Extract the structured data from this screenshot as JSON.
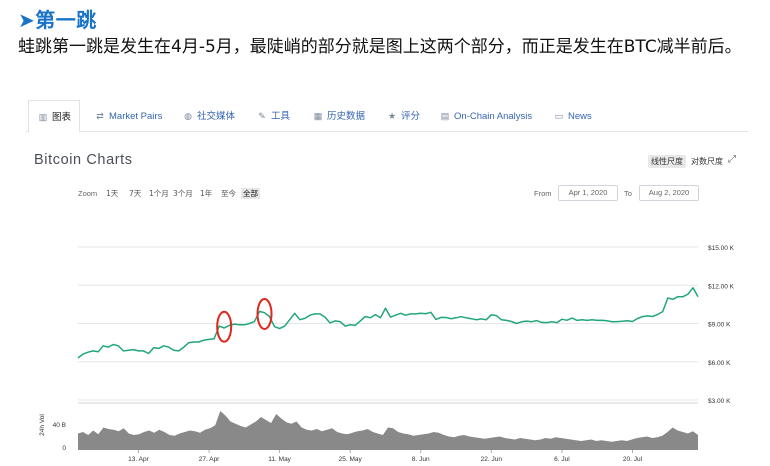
{
  "article": {
    "heading": "➤第一跳",
    "body": "蛙跳第一跳是发生在4月-5月，最陡峭的部分就是图上这两个部分，而正是发生在BTC减半前后。"
  },
  "tabs": [
    {
      "label": "图表",
      "icon": "chart-icon",
      "active": true
    },
    {
      "label": "Market Pairs",
      "icon": "exchange-icon"
    },
    {
      "label": "社交媒体",
      "icon": "globe-icon"
    },
    {
      "label": "工具",
      "icon": "wrench-icon"
    },
    {
      "label": "历史数据",
      "icon": "calendar-icon"
    },
    {
      "label": "评分",
      "icon": "star-icon"
    },
    {
      "label": "On-Chain Analysis",
      "icon": "line-chart-icon"
    },
    {
      "label": "News",
      "icon": "newspaper-icon"
    }
  ],
  "chart_header": {
    "title": "Bitcoin Charts",
    "linear_scale": "线性尺度",
    "log_scale": "对数尺度",
    "active_scale": "linear"
  },
  "zoom": {
    "label": "Zoom",
    "options": [
      "1天",
      "7天",
      "1个月",
      "3个月",
      "1年",
      "至今",
      "全部"
    ],
    "active": "全部"
  },
  "date_range": {
    "from_label": "From",
    "from_value": "Apr 1, 2020",
    "to_label": "To",
    "to_value": "Aug 2, 2020"
  },
  "chart_data": {
    "type": "area",
    "line_color": "#21a67a",
    "volume_color": "#7c7c7c",
    "grid": true,
    "y_ticks": [
      "$15.00 K",
      "$12.00 K",
      "$9.00 K",
      "$6.00 K",
      "$3.00 K"
    ],
    "y_tick_values": [
      15000,
      12000,
      9000,
      6000,
      3000
    ],
    "ylim": [
      3000,
      15000
    ],
    "x_ticks": [
      "13. Apr",
      "27. Apr",
      "11. May",
      "25. May",
      "8. Jun",
      "22. Jun",
      "6. Jul",
      "20. Jul"
    ],
    "volume_ylabel": "24h Vol",
    "volume_ticks": [
      "40 B",
      "0"
    ],
    "volume_ylim": [
      0,
      60
    ],
    "price_series": [
      {
        "date": "Apr 1",
        "value": 6300
      },
      {
        "date": "Apr 2",
        "value": 6600
      },
      {
        "date": "Apr 3",
        "value": 6750
      },
      {
        "date": "Apr 4",
        "value": 6850
      },
      {
        "date": "Apr 5",
        "value": 6780
      },
      {
        "date": "Apr 6",
        "value": 7250
      },
      {
        "date": "Apr 7",
        "value": 7150
      },
      {
        "date": "Apr 8",
        "value": 7350
      },
      {
        "date": "Apr 9",
        "value": 7250
      },
      {
        "date": "Apr 10",
        "value": 6850
      },
      {
        "date": "Apr 11",
        "value": 6900
      },
      {
        "date": "Apr 12",
        "value": 6950
      },
      {
        "date": "Apr 13",
        "value": 6850
      },
      {
        "date": "Apr 14",
        "value": 6850
      },
      {
        "date": "Apr 15",
        "value": 6650
      },
      {
        "date": "Apr 16",
        "value": 7100
      },
      {
        "date": "Apr 17",
        "value": 7050
      },
      {
        "date": "Apr 18",
        "value": 7250
      },
      {
        "date": "Apr 19",
        "value": 7150
      },
      {
        "date": "Apr 20",
        "value": 6900
      },
      {
        "date": "Apr 21",
        "value": 6850
      },
      {
        "date": "Apr 22",
        "value": 7150
      },
      {
        "date": "Apr 23",
        "value": 7500
      },
      {
        "date": "Apr 24",
        "value": 7550
      },
      {
        "date": "Apr 25",
        "value": 7550
      },
      {
        "date": "Apr 26",
        "value": 7700
      },
      {
        "date": "Apr 27",
        "value": 7750
      },
      {
        "date": "Apr 28",
        "value": 7800
      },
      {
        "date": "Apr 29",
        "value": 8800
      },
      {
        "date": "Apr 30",
        "value": 8650
      },
      {
        "date": "May 1",
        "value": 8850
      },
      {
        "date": "May 2",
        "value": 8950
      },
      {
        "date": "May 3",
        "value": 8900
      },
      {
        "date": "May 4",
        "value": 8900
      },
      {
        "date": "May 5",
        "value": 9000
      },
      {
        "date": "May 6",
        "value": 9150
      },
      {
        "date": "May 7",
        "value": 9950
      },
      {
        "date": "May 8",
        "value": 9850
      },
      {
        "date": "May 9",
        "value": 9550
      },
      {
        "date": "May 10",
        "value": 8750
      },
      {
        "date": "May 11",
        "value": 8600
      },
      {
        "date": "May 12",
        "value": 8800
      },
      {
        "date": "May 13",
        "value": 9300
      },
      {
        "date": "May 14",
        "value": 9800
      },
      {
        "date": "May 15",
        "value": 9300
      },
      {
        "date": "May 16",
        "value": 9400
      },
      {
        "date": "May 17",
        "value": 9650
      },
      {
        "date": "May 18",
        "value": 9750
      },
      {
        "date": "May 19",
        "value": 9750
      },
      {
        "date": "May 20",
        "value": 9500
      },
      {
        "date": "May 21",
        "value": 9050
      },
      {
        "date": "May 22",
        "value": 9200
      },
      {
        "date": "May 23",
        "value": 9150
      },
      {
        "date": "May 24",
        "value": 8800
      },
      {
        "date": "May 25",
        "value": 8900
      },
      {
        "date": "May 26",
        "value": 8850
      },
      {
        "date": "May 27",
        "value": 9200
      },
      {
        "date": "May 28",
        "value": 9550
      },
      {
        "date": "May 29",
        "value": 9450
      },
      {
        "date": "May 30",
        "value": 9700
      },
      {
        "date": "May 31",
        "value": 9450
      },
      {
        "date": "Jun 1",
        "value": 10200
      },
      {
        "date": "Jun 2",
        "value": 9500
      },
      {
        "date": "Jun 3",
        "value": 9650
      },
      {
        "date": "Jun 4",
        "value": 9800
      },
      {
        "date": "Jun 5",
        "value": 9650
      },
      {
        "date": "Jun 6",
        "value": 9750
      },
      {
        "date": "Jun 7",
        "value": 9750
      },
      {
        "date": "Jun 8",
        "value": 9800
      },
      {
        "date": "Jun 9",
        "value": 9770
      },
      {
        "date": "Jun 10",
        "value": 9880
      },
      {
        "date": "Jun 11",
        "value": 9320
      },
      {
        "date": "Jun 12",
        "value": 9480
      },
      {
        "date": "Jun 13",
        "value": 9470
      },
      {
        "date": "Jun 14",
        "value": 9380
      },
      {
        "date": "Jun 15",
        "value": 9450
      },
      {
        "date": "Jun 16",
        "value": 9530
      },
      {
        "date": "Jun 17",
        "value": 9450
      },
      {
        "date": "Jun 18",
        "value": 9380
      },
      {
        "date": "Jun 19",
        "value": 9300
      },
      {
        "date": "Jun 20",
        "value": 9360
      },
      {
        "date": "Jun 21",
        "value": 9300
      },
      {
        "date": "Jun 22",
        "value": 9680
      },
      {
        "date": "Jun 23",
        "value": 9620
      },
      {
        "date": "Jun 24",
        "value": 9290
      },
      {
        "date": "Jun 25",
        "value": 9240
      },
      {
        "date": "Jun 26",
        "value": 9160
      },
      {
        "date": "Jun 27",
        "value": 9000
      },
      {
        "date": "Jun 28",
        "value": 9130
      },
      {
        "date": "Jun 29",
        "value": 9190
      },
      {
        "date": "Jun 30",
        "value": 9140
      },
      {
        "date": "Jul 1",
        "value": 9230
      },
      {
        "date": "Jul 2",
        "value": 9090
      },
      {
        "date": "Jul 3",
        "value": 9070
      },
      {
        "date": "Jul 4",
        "value": 9130
      },
      {
        "date": "Jul 5",
        "value": 9070
      },
      {
        "date": "Jul 6",
        "value": 9340
      },
      {
        "date": "Jul 7",
        "value": 9250
      },
      {
        "date": "Jul 8",
        "value": 9430
      },
      {
        "date": "Jul 9",
        "value": 9240
      },
      {
        "date": "Jul 10",
        "value": 9290
      },
      {
        "date": "Jul 11",
        "value": 9240
      },
      {
        "date": "Jul 12",
        "value": 9300
      },
      {
        "date": "Jul 13",
        "value": 9240
      },
      {
        "date": "Jul 14",
        "value": 9250
      },
      {
        "date": "Jul 15",
        "value": 9200
      },
      {
        "date": "Jul 16",
        "value": 9130
      },
      {
        "date": "Jul 17",
        "value": 9150
      },
      {
        "date": "Jul 18",
        "value": 9170
      },
      {
        "date": "Jul 19",
        "value": 9210
      },
      {
        "date": "Jul 20",
        "value": 9160
      },
      {
        "date": "Jul 21",
        "value": 9390
      },
      {
        "date": "Jul 22",
        "value": 9540
      },
      {
        "date": "Jul 23",
        "value": 9600
      },
      {
        "date": "Jul 24",
        "value": 9550
      },
      {
        "date": "Jul 25",
        "value": 9710
      },
      {
        "date": "Jul 26",
        "value": 9930
      },
      {
        "date": "Jul 27",
        "value": 11000
      },
      {
        "date": "Jul 28",
        "value": 10900
      },
      {
        "date": "Jul 29",
        "value": 11100
      },
      {
        "date": "Jul 30",
        "value": 11100
      },
      {
        "date": "Jul 31",
        "value": 11300
      },
      {
        "date": "Aug 1",
        "value": 11800
      },
      {
        "date": "Aug 2",
        "value": 11100
      }
    ],
    "volume_series": [
      22,
      24,
      20,
      26,
      21,
      30,
      28,
      27,
      25,
      29,
      22,
      20,
      21,
      24,
      26,
      23,
      27,
      24,
      20,
      19,
      22,
      24,
      26,
      25,
      23,
      27,
      29,
      33,
      52,
      46,
      38,
      35,
      32,
      30,
      34,
      38,
      44,
      40,
      36,
      48,
      42,
      37,
      35,
      38,
      30,
      27,
      26,
      28,
      25,
      27,
      29,
      24,
      22,
      21,
      23,
      25,
      26,
      28,
      24,
      22,
      20,
      30,
      29,
      24,
      22,
      21,
      19,
      20,
      21,
      22,
      24,
      23,
      20,
      18,
      17,
      19,
      20,
      18,
      17,
      16,
      15,
      16,
      17,
      18,
      16,
      15,
      14,
      16,
      15,
      14,
      13,
      14,
      16,
      15,
      17,
      16,
      15,
      14,
      13,
      12,
      13,
      14,
      12,
      13,
      12,
      11,
      12,
      13,
      12,
      14,
      16,
      17,
      18,
      16,
      17,
      19,
      24,
      30,
      26,
      24,
      22,
      25,
      20
    ],
    "highlights": [
      {
        "label": "circle-1",
        "start": "Apr 29",
        "end": "May 1"
      },
      {
        "label": "circle-2",
        "start": "May 7",
        "end": "May 9"
      }
    ]
  }
}
